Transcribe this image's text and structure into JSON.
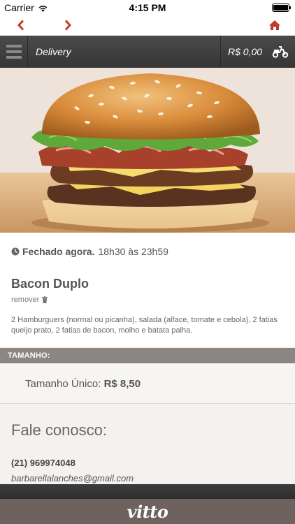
{
  "status_bar": {
    "carrier": "Carrier",
    "time": "4:15 PM"
  },
  "nav": {
    "back_icon": "chevron-left-icon",
    "forward_icon": "chevron-right-icon",
    "home_icon": "home-icon"
  },
  "toolbar": {
    "title": "Delivery",
    "cart_amount": "R$ 0,00",
    "cart_icon": "scooter-icon"
  },
  "hero": {
    "image": "bacon-burger-photo"
  },
  "store": {
    "status": "Fechado agora.",
    "hours": "18h30 às 23h59"
  },
  "product": {
    "name": "Bacon Duplo",
    "remove_label": "remover",
    "description": "2 Hamburguers (normal ou picanha), salada (alface, tomate e cebola), 2 fatias queijo prato, 2 fatias de bacon, molho e batata palha."
  },
  "size": {
    "header": "TAMANHO:",
    "option_label": "Tamanho Único:",
    "option_price": "R$ 8,50"
  },
  "contact": {
    "title": "Fale conosco:",
    "phone": "(21) 969974048",
    "email": "barbarellalanches@gmail.com"
  },
  "footer": {
    "logo": "vitto"
  },
  "colors": {
    "accent_red": "#c0392b",
    "toolbar": "#3c3c3c",
    "size_header": "#8c8683",
    "footer": "#6e625e"
  }
}
